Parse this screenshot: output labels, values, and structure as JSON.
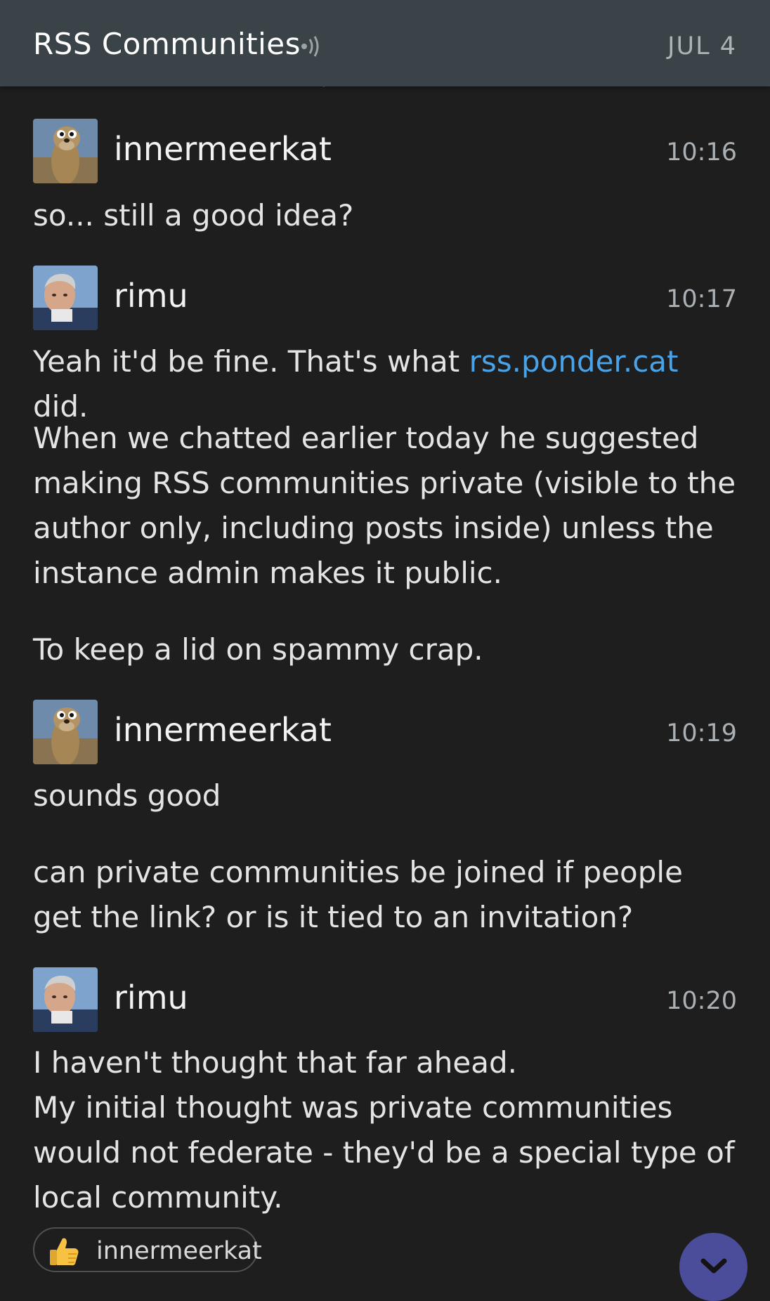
{
  "header": {
    "title": "RSS Communities",
    "date": "JUL 4"
  },
  "messages": [
    {
      "user": "innermeerkat",
      "time": "10:16",
      "paragraphs": [
        "so... still a good idea?"
      ]
    },
    {
      "user": "rimu",
      "time": "10:17",
      "first_pre": "Yeah it'd be fine. That's what ",
      "first_link": "rss.ponder.cat",
      "first_post": " did.",
      "paragraphs": [
        "When we chatted earlier today he suggested making RSS communities private (visible to the author only, including posts inside) unless the instance admin makes it public.",
        "To keep a lid on spammy crap."
      ]
    },
    {
      "user": "innermeerkat",
      "time": "10:19",
      "paragraphs": [
        "sounds good",
        "can private communities be joined if people get the link? or is it tied to an invitation?"
      ]
    },
    {
      "user": "rimu",
      "time": "10:20",
      "paragraphs": [
        "I haven't thought that far ahead.",
        "My initial thought was private communities would not federate - they'd be a special type of local community."
      ]
    }
  ],
  "reaction": {
    "emoji": "thumbs-up",
    "user": "innermeerkat"
  },
  "icons": {
    "speaker": "speaker-icon",
    "scroll_down": "chevron-down-icon"
  },
  "colors": {
    "header_bg": "#3a4448",
    "background": "#1e1e1f",
    "link": "#4aa3e6",
    "scroll_button": "#4b4d9b"
  }
}
